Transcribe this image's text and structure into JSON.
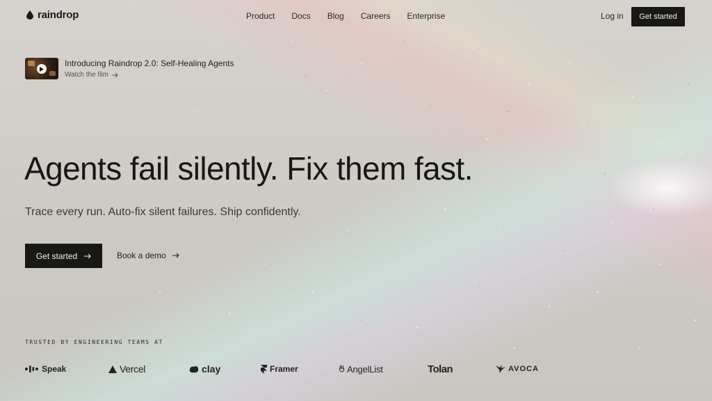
{
  "nav": {
    "brand": "raindrop",
    "links": [
      "Product",
      "Docs",
      "Blog",
      "Careers",
      "Enterprise"
    ],
    "login": "Log in",
    "cta": "Get started"
  },
  "announcement": {
    "title": "Introducing Raindrop 2.0: Self-Healing Agents",
    "link": "Watch the film"
  },
  "hero": {
    "headline": "Agents fail silently. Fix them fast.",
    "subheadline": "Trace every run. Auto-fix silent failures. Ship confidently.",
    "primary_cta": "Get started",
    "secondary_cta": "Book a demo"
  },
  "trusted": {
    "label": "TRUSTED BY ENGINEERING TEAMS AT",
    "logos": [
      "Speak",
      "Vercel",
      "clay",
      "Framer",
      "AngelList",
      "Tolan",
      "AVOCA"
    ]
  },
  "colors": {
    "ink": "#181815",
    "background": "#cfccc6",
    "button_text": "#f2f0ec"
  }
}
